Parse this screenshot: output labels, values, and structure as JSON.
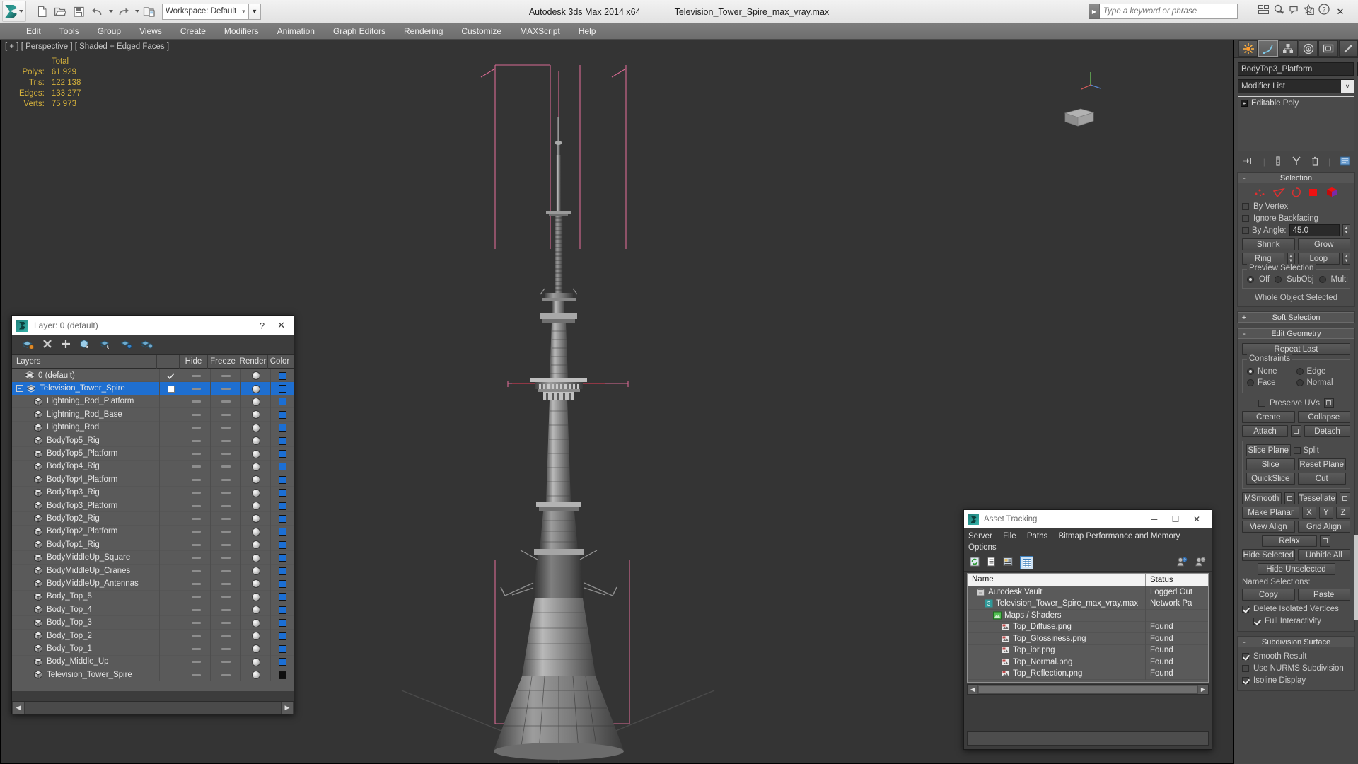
{
  "app": {
    "title": "Autodesk 3ds Max  2014 x64",
    "filename": "Television_Tower_Spire_max_vray.max",
    "workspace_label": "Workspace: Default",
    "search_placeholder": "Type a keyword or phrase",
    "window_buttons": {
      "minimize": "─",
      "maximize": "☐",
      "close": "✕"
    }
  },
  "menubar": {
    "items": [
      "Edit",
      "Tools",
      "Group",
      "Views",
      "Create",
      "Modifiers",
      "Animation",
      "Graph Editors",
      "Rendering",
      "Customize",
      "MAXScript",
      "Help"
    ]
  },
  "quick_access": {
    "icons": [
      "new-file-icon",
      "open-file-icon",
      "save-file-icon",
      "undo-icon",
      "redo-icon",
      "set-project-folder-icon"
    ]
  },
  "viewport": {
    "label": "[ + ] [ Perspective ] [ Shaded + Edged Faces ]",
    "stats": {
      "header": "Total",
      "rows": [
        {
          "label": "Polys:",
          "value": "61 929"
        },
        {
          "label": "Tris:",
          "value": "122 138"
        },
        {
          "label": "Edges:",
          "value": "133 277"
        },
        {
          "label": "Verts:",
          "value": "75 973"
        }
      ]
    }
  },
  "layer_dialog": {
    "title": "Layer: 0 (default)",
    "help_label": "?",
    "close_label": "✕",
    "toolbar_icons": [
      "create-new-layer-icon",
      "delete-layer-icon",
      "add-selection-icon",
      "select-layer-objects-icon",
      "select-highlighted-objects-icon",
      "highlight-selected-objects-icon",
      "layer-properties-icon"
    ],
    "columns": [
      "Layers",
      "Hide",
      "Freeze",
      "Render",
      "Color"
    ],
    "rows": [
      {
        "name": "0 (default)",
        "indent": 1,
        "icon": "layer-icon",
        "selected": false,
        "current": true,
        "color": "#1c6fd4"
      },
      {
        "name": "Television_Tower_Spire",
        "indent": 0,
        "icon": "layer-icon",
        "selected": true,
        "current": false,
        "expandable": true,
        "color": "#1c6fd4"
      },
      {
        "name": "Lightning_Rod_Platform",
        "indent": 2,
        "icon": "object-icon",
        "selected": false,
        "color": "#1c6fd4"
      },
      {
        "name": "Lightning_Rod_Base",
        "indent": 2,
        "icon": "object-icon",
        "selected": false,
        "color": "#1c6fd4"
      },
      {
        "name": "Lightning_Rod",
        "indent": 2,
        "icon": "object-icon",
        "selected": false,
        "color": "#1c6fd4"
      },
      {
        "name": "BodyTop5_Rig",
        "indent": 2,
        "icon": "object-icon",
        "selected": false,
        "color": "#1c6fd4"
      },
      {
        "name": "BodyTop5_Platform",
        "indent": 2,
        "icon": "object-icon",
        "selected": false,
        "color": "#1c6fd4"
      },
      {
        "name": "BodyTop4_Rig",
        "indent": 2,
        "icon": "object-icon",
        "selected": false,
        "color": "#1c6fd4"
      },
      {
        "name": "BodyTop4_Platform",
        "indent": 2,
        "icon": "object-icon",
        "selected": false,
        "color": "#1c6fd4"
      },
      {
        "name": "BodyTop3_Rig",
        "indent": 2,
        "icon": "object-icon",
        "selected": false,
        "color": "#1c6fd4"
      },
      {
        "name": "BodyTop3_Platform",
        "indent": 2,
        "icon": "object-icon",
        "selected": false,
        "color": "#1c6fd4"
      },
      {
        "name": "BodyTop2_Rig",
        "indent": 2,
        "icon": "object-icon",
        "selected": false,
        "color": "#1c6fd4"
      },
      {
        "name": "BodyTop2_Platform",
        "indent": 2,
        "icon": "object-icon",
        "selected": false,
        "color": "#1c6fd4"
      },
      {
        "name": "BodyTop1_Rig",
        "indent": 2,
        "icon": "object-icon",
        "selected": false,
        "color": "#1c6fd4"
      },
      {
        "name": "BodyMiddleUp_Square",
        "indent": 2,
        "icon": "object-icon",
        "selected": false,
        "color": "#1c6fd4"
      },
      {
        "name": "BodyMiddleUp_Cranes",
        "indent": 2,
        "icon": "object-icon",
        "selected": false,
        "color": "#1c6fd4"
      },
      {
        "name": "BodyMiddleUp_Antennas",
        "indent": 2,
        "icon": "object-icon",
        "selected": false,
        "color": "#1c6fd4"
      },
      {
        "name": "Body_Top_5",
        "indent": 2,
        "icon": "object-icon",
        "selected": false,
        "color": "#1c6fd4"
      },
      {
        "name": "Body_Top_4",
        "indent": 2,
        "icon": "object-icon",
        "selected": false,
        "color": "#1c6fd4"
      },
      {
        "name": "Body_Top_3",
        "indent": 2,
        "icon": "object-icon",
        "selected": false,
        "color": "#1c6fd4"
      },
      {
        "name": "Body_Top_2",
        "indent": 2,
        "icon": "object-icon",
        "selected": false,
        "color": "#1c6fd4"
      },
      {
        "name": "Body_Top_1",
        "indent": 2,
        "icon": "object-icon",
        "selected": false,
        "color": "#1c6fd4"
      },
      {
        "name": "Body_Middle_Up",
        "indent": 2,
        "icon": "object-icon",
        "selected": false,
        "color": "#1c6fd4"
      },
      {
        "name": "Television_Tower_Spire",
        "indent": 2,
        "icon": "object-icon",
        "selected": false,
        "color": "#0e0e0e"
      }
    ]
  },
  "asset_dialog": {
    "title": "Asset Tracking",
    "window_buttons": {
      "minimize": "─",
      "maximize": "☐",
      "close": "✕"
    },
    "menus": [
      "Server",
      "File",
      "Paths",
      "Bitmap Performance and Memory",
      "Options"
    ],
    "toolbar_icons": [
      "refresh-icon",
      "list-view-icon",
      "detail-view-icon",
      "grid-view-icon",
      "add-user-icon",
      "remove-user-icon"
    ],
    "columns": [
      "Name",
      "Status"
    ],
    "rows": [
      {
        "name": "Autodesk Vault",
        "status": "Logged Out",
        "indent": 1,
        "icon": "vault-icon"
      },
      {
        "name": "Television_Tower_Spire_max_vray.max",
        "status": "Network Pa",
        "indent": 2,
        "icon": "max-file-icon"
      },
      {
        "name": "Maps / Shaders",
        "status": "",
        "indent": 3,
        "icon": "maps-icon"
      },
      {
        "name": "Top_Diffuse.png",
        "status": "Found",
        "indent": 4,
        "icon": "bitmap-icon"
      },
      {
        "name": "Top_Glossiness.png",
        "status": "Found",
        "indent": 4,
        "icon": "bitmap-icon"
      },
      {
        "name": "Top_ior.png",
        "status": "Found",
        "indent": 4,
        "icon": "bitmap-icon"
      },
      {
        "name": "Top_Normal.png",
        "status": "Found",
        "indent": 4,
        "icon": "bitmap-icon"
      },
      {
        "name": "Top_Reflection.png",
        "status": "Found",
        "indent": 4,
        "icon": "bitmap-icon"
      }
    ],
    "scroll_left": "◀",
    "scroll_right": "▶"
  },
  "command_panel": {
    "tabs": [
      "create-tab",
      "modify-tab",
      "hierarchy-tab",
      "motion-tab",
      "display-tab",
      "utilities-tab"
    ],
    "active_tab_index": 1,
    "object_name": "BodyTop3_Platform",
    "modifier_list_label": "Modifier List",
    "modifier_stack": [
      {
        "label": "Editable Poly",
        "expand": "+"
      }
    ],
    "selection": {
      "header": "Selection",
      "collapse": "-",
      "sub_object_levels": [
        "vertex-icon",
        "edge-icon",
        "border-icon",
        "polygon-icon",
        "element-icon"
      ],
      "by_vertex": "By Vertex",
      "ignore_backfacing": "Ignore Backfacing",
      "by_angle": "By Angle:",
      "by_angle_value": "45.0",
      "shrink": "Shrink",
      "grow": "Grow",
      "ring": "Ring",
      "loop": "Loop",
      "preview_selection": "Preview Selection",
      "preview_off": "Off",
      "preview_subobj": "SubObj",
      "preview_multi": "Multi",
      "status": "Whole Object Selected"
    },
    "soft_selection": {
      "header": "Soft Selection",
      "expand": "+"
    },
    "edit_geometry": {
      "header": "Edit Geometry",
      "collapse": "-",
      "repeat_last": "Repeat Last",
      "constraints": "Constraints",
      "constraint_none": "None",
      "constraint_edge": "Edge",
      "constraint_face": "Face",
      "constraint_normal": "Normal",
      "preserve_uvs": "Preserve UVs",
      "create": "Create",
      "collapse_btn": "Collapse",
      "attach": "Attach",
      "detach": "Detach",
      "slice_plane": "Slice Plane",
      "split": "Split",
      "slice": "Slice",
      "reset_plane": "Reset Plane",
      "quickslice": "QuickSlice",
      "cut": "Cut",
      "msmooth": "MSmooth",
      "tessellate": "Tessellate",
      "make_planar": "Make Planar",
      "axis_x": "X",
      "axis_y": "Y",
      "axis_z": "Z",
      "view_align": "View Align",
      "grid_align": "Grid Align",
      "relax": "Relax",
      "hide_selected": "Hide Selected",
      "unhide_all": "Unhide All",
      "hide_unselected": "Hide Unselected",
      "named_selections": "Named Selections:",
      "copy": "Copy",
      "paste": "Paste",
      "delete_isolated_vertices": "Delete Isolated Vertices",
      "full_interactivity": "Full Interactivity"
    },
    "subdivision_surface": {
      "header": "Subdivision Surface",
      "collapse": "-",
      "smooth_result": "Smooth Result",
      "use_nurms": "Use NURMS Subdivision",
      "isoline_display": "Isoline Display"
    }
  },
  "colors": {
    "viewport_bg": "#343434",
    "selection_blue": "#1f6fd0",
    "stats_yellow": "#d6b23c",
    "helper_pink": "#d96a93",
    "panel_bg": "#474747"
  }
}
